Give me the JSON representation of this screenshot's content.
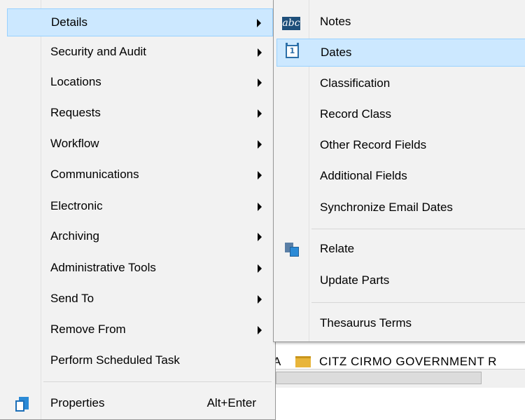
{
  "background": {
    "row_prefix": "A",
    "row_text": "CITZ CIRMO GOVERNMENT R"
  },
  "main_menu": {
    "items": [
      {
        "label": "Details",
        "submenu": true
      },
      {
        "label": "Security and Audit",
        "submenu": true
      },
      {
        "label": "Locations",
        "submenu": true
      },
      {
        "label": "Requests",
        "submenu": true
      },
      {
        "label": "Workflow",
        "submenu": true
      },
      {
        "label": "Communications",
        "submenu": true
      },
      {
        "label": "Electronic",
        "submenu": true
      },
      {
        "label": "Archiving",
        "submenu": true
      },
      {
        "label": "Administrative Tools",
        "submenu": true
      },
      {
        "label": "Send To",
        "submenu": true
      },
      {
        "label": "Remove From",
        "submenu": true
      },
      {
        "label": "Perform Scheduled Task",
        "submenu": false
      },
      {
        "label": "Properties",
        "shortcut": "Alt+Enter",
        "icon": "properties-icon"
      }
    ]
  },
  "sub_menu": {
    "items": [
      {
        "label": "Notes",
        "icon": "abc-notes-icon"
      },
      {
        "label": "Dates",
        "icon": "calendar-icon"
      },
      {
        "label": "Classification"
      },
      {
        "label": "Record Class"
      },
      {
        "label": "Other Record Fields"
      },
      {
        "label": "Additional Fields"
      },
      {
        "label": "Synchronize Email Dates"
      },
      {
        "label": "Relate",
        "icon": "relate-icon"
      },
      {
        "label": "Update Parts"
      },
      {
        "label": "Thesaurus Terms"
      }
    ],
    "icon_text": {
      "abc": "abc",
      "cal": "1"
    }
  },
  "colors": {
    "highlight_bg": "#cce8ff",
    "highlight_border": "#99d1ff",
    "menu_bg": "#f2f2f2"
  }
}
